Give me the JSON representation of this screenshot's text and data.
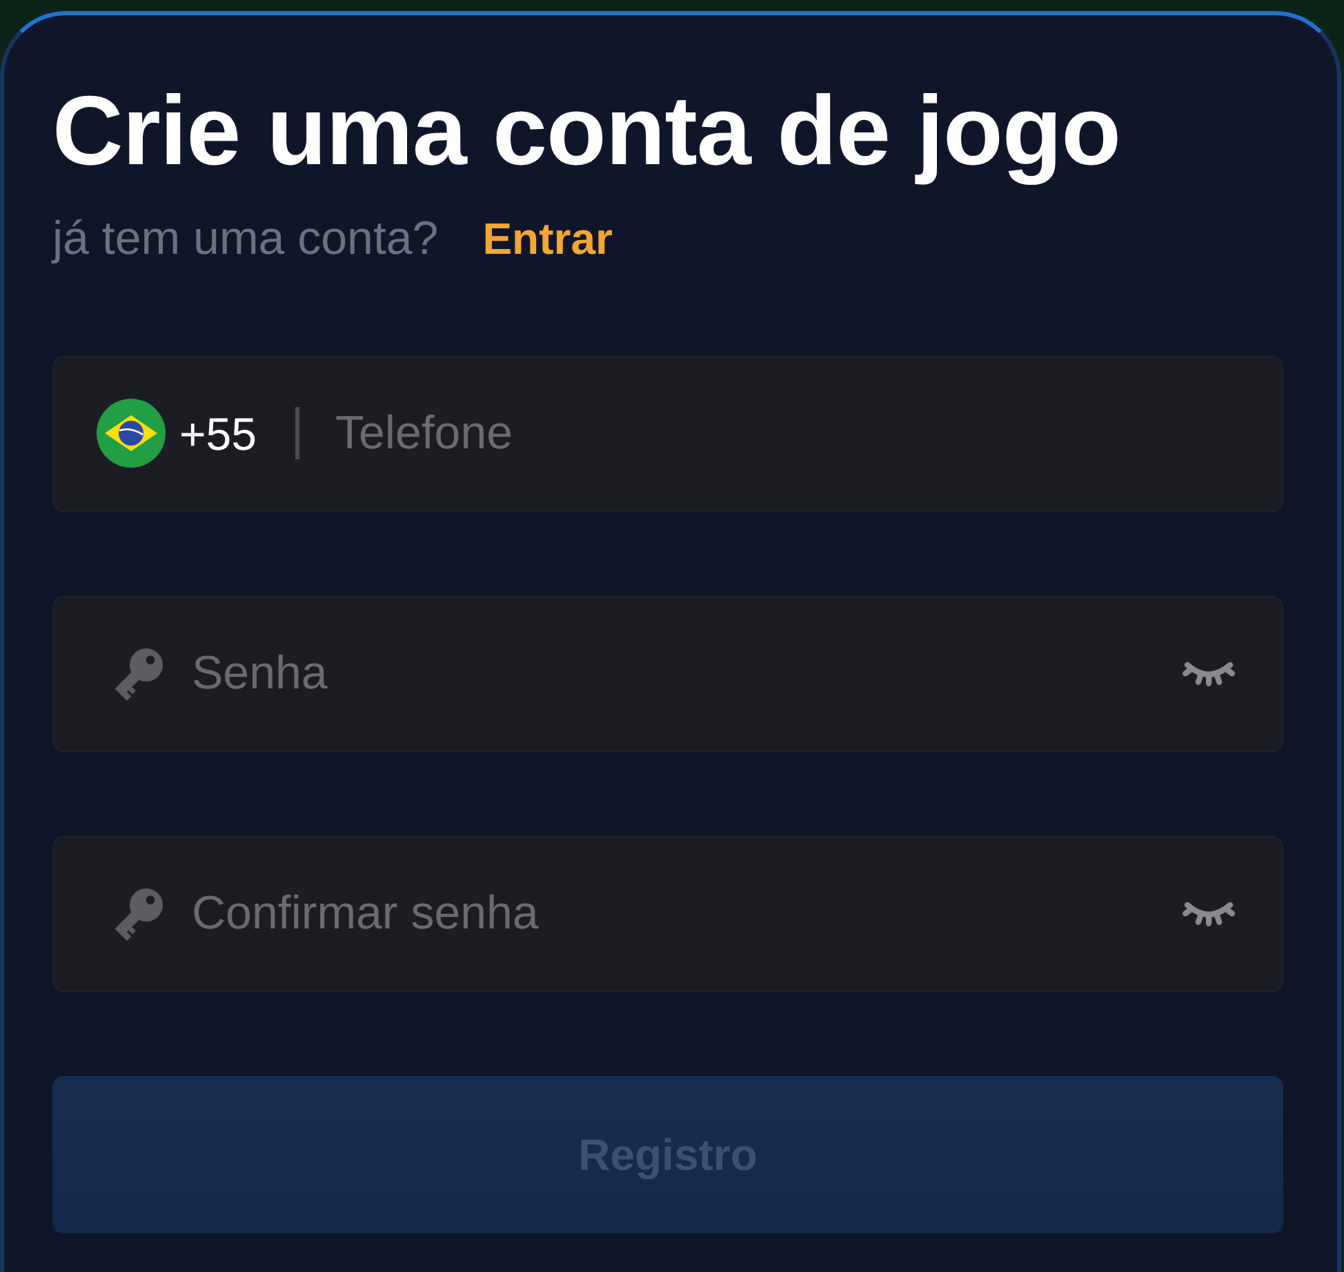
{
  "title": "Crie uma conta de jogo",
  "login_prompt": {
    "text": "já tem uma conta?",
    "link": "Entrar"
  },
  "fields": [
    {
      "kind": "phone",
      "country_code": "+55",
      "placeholder": "Telefone"
    },
    {
      "kind": "password",
      "placeholder": "Senha",
      "visible": false
    },
    {
      "kind": "password",
      "placeholder": "Confirmar senha",
      "visible": false
    }
  ],
  "submit": {
    "label": "Registro",
    "disabled": true
  }
}
